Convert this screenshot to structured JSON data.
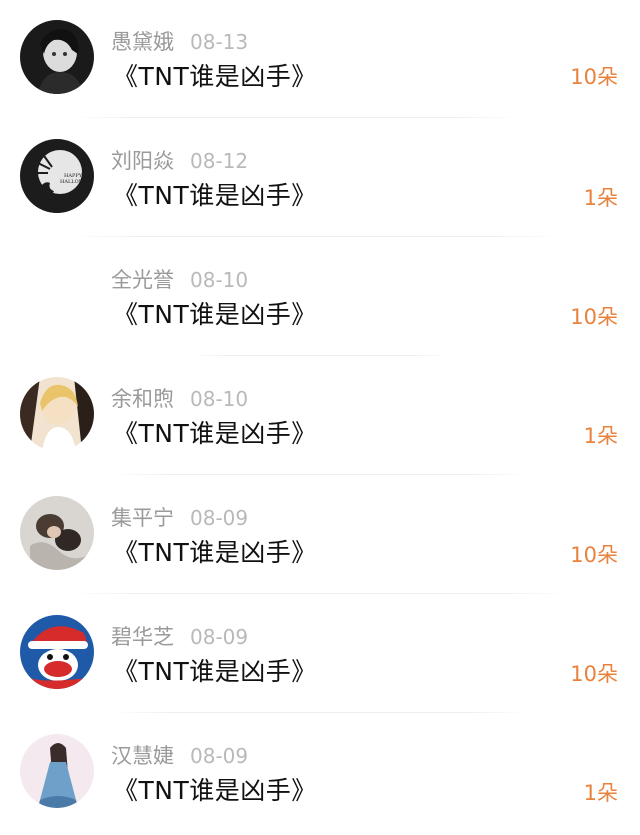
{
  "entries": [
    {
      "name": "愚黛娥",
      "date": "08-13",
      "title": "《TNT谁是凶手》",
      "gift": "10朵",
      "avatar": "avatar-portrait-dark-icon"
    },
    {
      "name": "刘阳焱",
      "date": "08-12",
      "title": "《TNT谁是凶手》",
      "gift": "1朵",
      "avatar": "avatar-halloween-icon"
    },
    {
      "name": "全光誉",
      "date": "08-10",
      "title": "《TNT谁是凶手》",
      "gift": "10朵",
      "avatar": "avatar-blank-icon"
    },
    {
      "name": "余和煦",
      "date": "08-10",
      "title": "《TNT谁是凶手》",
      "gift": "1朵",
      "avatar": "avatar-anime-blond-icon"
    },
    {
      "name": "集平宁",
      "date": "08-09",
      "title": "《TNT谁是凶手》",
      "gift": "10朵",
      "avatar": "avatar-sleeping-couple-icon"
    },
    {
      "name": "碧华芝",
      "date": "08-09",
      "title": "《TNT谁是凶手》",
      "gift": "10朵",
      "avatar": "avatar-monkey-santa-icon"
    },
    {
      "name": "汉慧婕",
      "date": "08-09",
      "title": "《TNT谁是凶手》",
      "gift": "1朵",
      "avatar": "avatar-girl-blue-dress-icon"
    }
  ],
  "colors": {
    "name": "#9a9a9a",
    "date": "#b9b9b9",
    "title": "#111111",
    "gift": "#e8823c"
  }
}
